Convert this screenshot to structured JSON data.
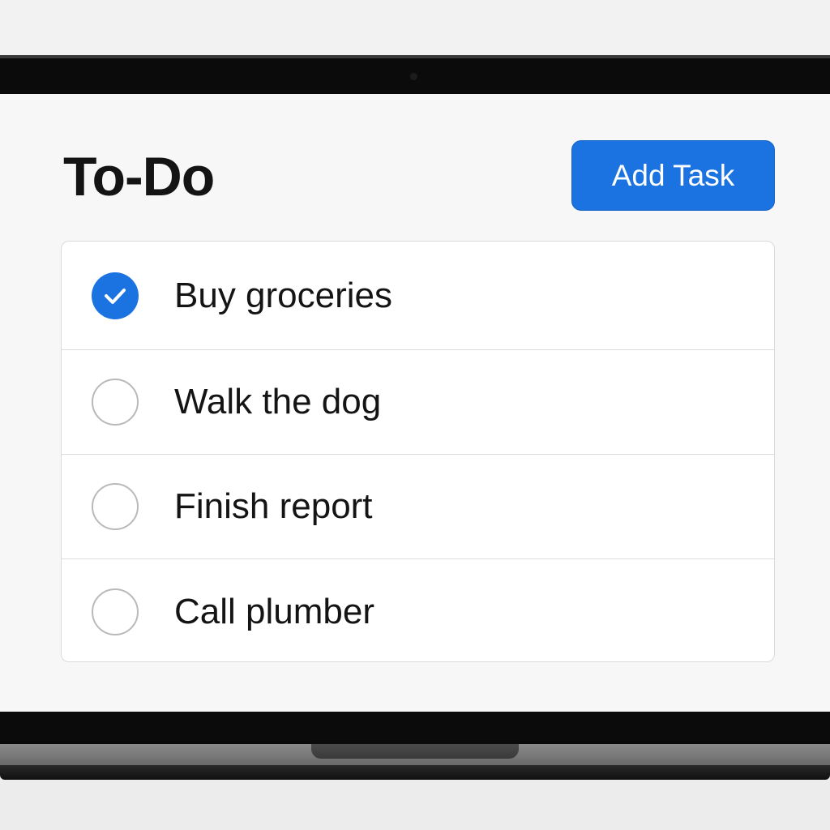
{
  "app": {
    "title": "To-Do",
    "add_button_label": "Add Task"
  },
  "tasks": [
    {
      "label": "Buy groceries",
      "completed": true
    },
    {
      "label": "Walk the dog",
      "completed": false
    },
    {
      "label": "Finish report",
      "completed": false
    },
    {
      "label": "Call plumber",
      "completed": false
    }
  ],
  "colors": {
    "accent": "#1a73e0",
    "text": "#141414",
    "unchecked_border": "#b9b9b9"
  }
}
